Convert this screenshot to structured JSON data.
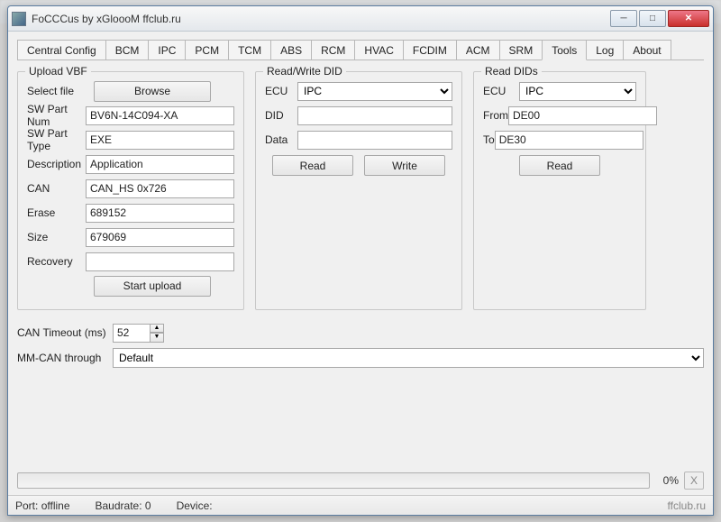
{
  "window": {
    "title": "FoCCCus by xGloooM ffclub.ru"
  },
  "tabs": [
    "Central Config",
    "BCM",
    "IPC",
    "PCM",
    "TCM",
    "ABS",
    "RCM",
    "HVAC",
    "FCDIM",
    "ACM",
    "SRM",
    "Tools",
    "Log",
    "About"
  ],
  "active_tab": 11,
  "upload": {
    "legend": "Upload VBF",
    "select_file_label": "Select file",
    "browse_label": "Browse",
    "fields": {
      "sw_part_num": {
        "label": "SW Part Num",
        "value": "BV6N-14C094-XA"
      },
      "sw_part_type": {
        "label": "SW Part Type",
        "value": "EXE"
      },
      "description": {
        "label": "Description",
        "value": "Application"
      },
      "can": {
        "label": "CAN",
        "value": "CAN_HS 0x726"
      },
      "erase": {
        "label": "Erase",
        "value": "689152"
      },
      "size": {
        "label": "Size",
        "value": "679069"
      },
      "recovery": {
        "label": "Recovery",
        "value": ""
      }
    },
    "start_label": "Start upload"
  },
  "rw_did": {
    "legend": "Read/Write DID",
    "ecu_label": "ECU",
    "ecu_value": "IPC",
    "did_label": "DID",
    "did_value": "",
    "data_label": "Data",
    "data_value": "",
    "read_label": "Read",
    "write_label": "Write"
  },
  "read_dids": {
    "legend": "Read DIDs",
    "ecu_label": "ECU",
    "ecu_value": "IPC",
    "from_label": "From",
    "from_value": "DE00",
    "to_label": "To",
    "to_value": "DE30",
    "read_label": "Read"
  },
  "lower": {
    "can_timeout_label": "CAN Timeout (ms)",
    "can_timeout_value": "52",
    "mmcan_label": "MM-CAN through",
    "mmcan_value": "Default"
  },
  "progress": {
    "percent": "0%",
    "cancel": "X"
  },
  "status": {
    "port_label": "Port:",
    "port_value": "offline",
    "baud_label": "Baudrate:",
    "baud_value": "0",
    "device_label": "Device:",
    "device_value": "",
    "brand": "ffclub.ru"
  }
}
